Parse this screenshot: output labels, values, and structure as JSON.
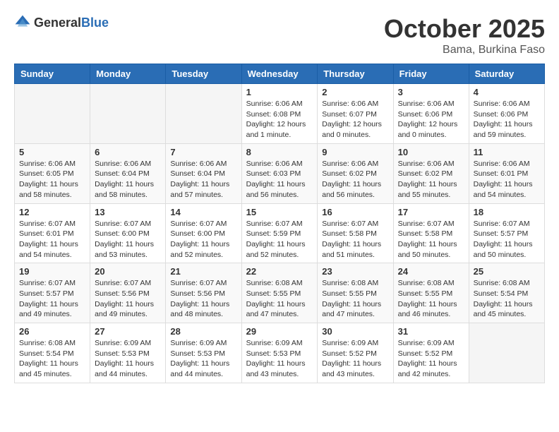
{
  "logo": {
    "general": "General",
    "blue": "Blue"
  },
  "header": {
    "month": "October 2025",
    "location": "Bama, Burkina Faso"
  },
  "weekdays": [
    "Sunday",
    "Monday",
    "Tuesday",
    "Wednesday",
    "Thursday",
    "Friday",
    "Saturday"
  ],
  "weeks": [
    [
      {
        "day": "",
        "sunrise": "",
        "sunset": "",
        "daylight": ""
      },
      {
        "day": "",
        "sunrise": "",
        "sunset": "",
        "daylight": ""
      },
      {
        "day": "",
        "sunrise": "",
        "sunset": "",
        "daylight": ""
      },
      {
        "day": "1",
        "sunrise": "Sunrise: 6:06 AM",
        "sunset": "Sunset: 6:08 PM",
        "daylight": "Daylight: 12 hours and 1 minute."
      },
      {
        "day": "2",
        "sunrise": "Sunrise: 6:06 AM",
        "sunset": "Sunset: 6:07 PM",
        "daylight": "Daylight: 12 hours and 0 minutes."
      },
      {
        "day": "3",
        "sunrise": "Sunrise: 6:06 AM",
        "sunset": "Sunset: 6:06 PM",
        "daylight": "Daylight: 12 hours and 0 minutes."
      },
      {
        "day": "4",
        "sunrise": "Sunrise: 6:06 AM",
        "sunset": "Sunset: 6:06 PM",
        "daylight": "Daylight: 11 hours and 59 minutes."
      }
    ],
    [
      {
        "day": "5",
        "sunrise": "Sunrise: 6:06 AM",
        "sunset": "Sunset: 6:05 PM",
        "daylight": "Daylight: 11 hours and 58 minutes."
      },
      {
        "day": "6",
        "sunrise": "Sunrise: 6:06 AM",
        "sunset": "Sunset: 6:04 PM",
        "daylight": "Daylight: 11 hours and 58 minutes."
      },
      {
        "day": "7",
        "sunrise": "Sunrise: 6:06 AM",
        "sunset": "Sunset: 6:04 PM",
        "daylight": "Daylight: 11 hours and 57 minutes."
      },
      {
        "day": "8",
        "sunrise": "Sunrise: 6:06 AM",
        "sunset": "Sunset: 6:03 PM",
        "daylight": "Daylight: 11 hours and 56 minutes."
      },
      {
        "day": "9",
        "sunrise": "Sunrise: 6:06 AM",
        "sunset": "Sunset: 6:02 PM",
        "daylight": "Daylight: 11 hours and 56 minutes."
      },
      {
        "day": "10",
        "sunrise": "Sunrise: 6:06 AM",
        "sunset": "Sunset: 6:02 PM",
        "daylight": "Daylight: 11 hours and 55 minutes."
      },
      {
        "day": "11",
        "sunrise": "Sunrise: 6:06 AM",
        "sunset": "Sunset: 6:01 PM",
        "daylight": "Daylight: 11 hours and 54 minutes."
      }
    ],
    [
      {
        "day": "12",
        "sunrise": "Sunrise: 6:07 AM",
        "sunset": "Sunset: 6:01 PM",
        "daylight": "Daylight: 11 hours and 54 minutes."
      },
      {
        "day": "13",
        "sunrise": "Sunrise: 6:07 AM",
        "sunset": "Sunset: 6:00 PM",
        "daylight": "Daylight: 11 hours and 53 minutes."
      },
      {
        "day": "14",
        "sunrise": "Sunrise: 6:07 AM",
        "sunset": "Sunset: 6:00 PM",
        "daylight": "Daylight: 11 hours and 52 minutes."
      },
      {
        "day": "15",
        "sunrise": "Sunrise: 6:07 AM",
        "sunset": "Sunset: 5:59 PM",
        "daylight": "Daylight: 11 hours and 52 minutes."
      },
      {
        "day": "16",
        "sunrise": "Sunrise: 6:07 AM",
        "sunset": "Sunset: 5:58 PM",
        "daylight": "Daylight: 11 hours and 51 minutes."
      },
      {
        "day": "17",
        "sunrise": "Sunrise: 6:07 AM",
        "sunset": "Sunset: 5:58 PM",
        "daylight": "Daylight: 11 hours and 50 minutes."
      },
      {
        "day": "18",
        "sunrise": "Sunrise: 6:07 AM",
        "sunset": "Sunset: 5:57 PM",
        "daylight": "Daylight: 11 hours and 50 minutes."
      }
    ],
    [
      {
        "day": "19",
        "sunrise": "Sunrise: 6:07 AM",
        "sunset": "Sunset: 5:57 PM",
        "daylight": "Daylight: 11 hours and 49 minutes."
      },
      {
        "day": "20",
        "sunrise": "Sunrise: 6:07 AM",
        "sunset": "Sunset: 5:56 PM",
        "daylight": "Daylight: 11 hours and 49 minutes."
      },
      {
        "day": "21",
        "sunrise": "Sunrise: 6:07 AM",
        "sunset": "Sunset: 5:56 PM",
        "daylight": "Daylight: 11 hours and 48 minutes."
      },
      {
        "day": "22",
        "sunrise": "Sunrise: 6:08 AM",
        "sunset": "Sunset: 5:55 PM",
        "daylight": "Daylight: 11 hours and 47 minutes."
      },
      {
        "day": "23",
        "sunrise": "Sunrise: 6:08 AM",
        "sunset": "Sunset: 5:55 PM",
        "daylight": "Daylight: 11 hours and 47 minutes."
      },
      {
        "day": "24",
        "sunrise": "Sunrise: 6:08 AM",
        "sunset": "Sunset: 5:55 PM",
        "daylight": "Daylight: 11 hours and 46 minutes."
      },
      {
        "day": "25",
        "sunrise": "Sunrise: 6:08 AM",
        "sunset": "Sunset: 5:54 PM",
        "daylight": "Daylight: 11 hours and 45 minutes."
      }
    ],
    [
      {
        "day": "26",
        "sunrise": "Sunrise: 6:08 AM",
        "sunset": "Sunset: 5:54 PM",
        "daylight": "Daylight: 11 hours and 45 minutes."
      },
      {
        "day": "27",
        "sunrise": "Sunrise: 6:09 AM",
        "sunset": "Sunset: 5:53 PM",
        "daylight": "Daylight: 11 hours and 44 minutes."
      },
      {
        "day": "28",
        "sunrise": "Sunrise: 6:09 AM",
        "sunset": "Sunset: 5:53 PM",
        "daylight": "Daylight: 11 hours and 44 minutes."
      },
      {
        "day": "29",
        "sunrise": "Sunrise: 6:09 AM",
        "sunset": "Sunset: 5:53 PM",
        "daylight": "Daylight: 11 hours and 43 minutes."
      },
      {
        "day": "30",
        "sunrise": "Sunrise: 6:09 AM",
        "sunset": "Sunset: 5:52 PM",
        "daylight": "Daylight: 11 hours and 43 minutes."
      },
      {
        "day": "31",
        "sunrise": "Sunrise: 6:09 AM",
        "sunset": "Sunset: 5:52 PM",
        "daylight": "Daylight: 11 hours and 42 minutes."
      },
      {
        "day": "",
        "sunrise": "",
        "sunset": "",
        "daylight": ""
      }
    ]
  ]
}
